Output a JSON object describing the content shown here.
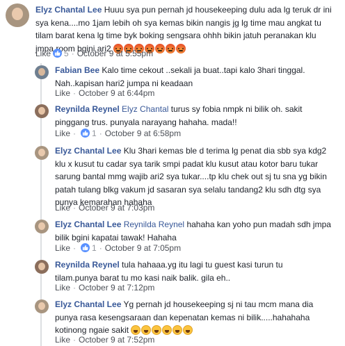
{
  "comments": [
    {
      "author": "Elyz Chantal Lee",
      "text": "Huuu sya pun pernah jd housekeeping dulu ada lg teruk dr ini sya kena....mo 1jam lebih oh sya kemas bikin nangis jg lg time mau angkat tu tilam barat kena lg time byk boking sengsara ohhh bikin jatuh peranakan klu jmpa room bgini ari2",
      "emoji_count": 7,
      "like": "Like",
      "reaction_count": "5",
      "time": "October 9 at 5:55pm"
    },
    {
      "author": "Fabian Bee",
      "text": "Kalo time cekout ..sekali ja buat..tapi kalo 3hari tinggal. Nah..kapisan hari2 jumpa ni keadaan",
      "like": "Like",
      "time": "October 9 at 6:44pm"
    },
    {
      "author": "Reynilda Reynel",
      "tag": "Elyz Chantal",
      "text": "turus sy fobia nmpk ni bilik oh. sakit pinggang trus. punyala narayang hahaha. mada!!",
      "like": "Like",
      "reaction_count": "1",
      "time": "October 9 at 6:58pm"
    },
    {
      "author": "Elyz Chantal Lee",
      "text": "Klu 3hari kemas ble d terima lg penat dia sbb sya kdg2 klu x kusut tu cadar sya tarik smpi padat klu kusut atau kotor baru tukar sarung bantal mmg wajib ari2 sya tukar....tp klu chek out sj tu sna yg bikin patah tulang blkg vakum jd sasaran sya selalu tandang2 klu sdh dtg sya punya kemarahan hahaha",
      "like": "Like",
      "time": "October 9 at 7:03pm"
    },
    {
      "author": "Elyz Chantal Lee",
      "tag": "Reynilda Reynel",
      "text": "hahaha kan yoho pun madah sdh jmpa bilik bgini kapatai tawak! Hahaha",
      "like": "Like",
      "reaction_count": "1",
      "time": "October 9 at 7:05pm"
    },
    {
      "author": "Reynilda Reynel",
      "text": "tula hahaaa.yg itu lagi tu guest kasi turun tu tilam.punya barat tu mo kasi naik balik. gila eh..",
      "like": "Like",
      "time": "October 9 at 7:12pm"
    },
    {
      "author": "Elyz Chantal Lee",
      "text": "Yg pernah jd housekeeping sj ni tau mcm mana dia punya rasa kesengsaraan dan kepenatan kemas ni bilik.....hahahaha kotinong ngaie sakit",
      "emoji_count": 6,
      "like": "Like",
      "time": "October 9 at 7:52pm"
    }
  ],
  "colors": {
    "link": "#385898",
    "meta": "#90949c",
    "like_badge": "#5890ff"
  },
  "icons": {
    "reaction": "thumbs-up-icon",
    "angry": "angry-face-icon",
    "laugh": "laughing-face-icon"
  }
}
